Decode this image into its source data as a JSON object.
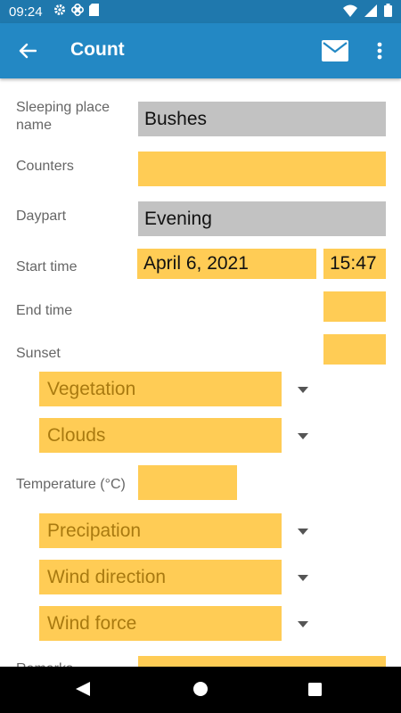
{
  "status_bar": {
    "time": "09:24"
  },
  "app_bar": {
    "title": "Count"
  },
  "form": {
    "sleeping_place_label": "Sleeping place name",
    "sleeping_place_value": "Bushes",
    "counters_label": "Counters",
    "counters_value": "",
    "daypart_label": "Daypart",
    "daypart_value": "Evening",
    "start_time_label": "Start time",
    "start_date_value": "April 6, 2021",
    "start_time_value": "15:47",
    "end_time_label": "End time",
    "end_time_value": "",
    "sunset_label": "Sunset",
    "sunset_value": "",
    "vegetation_value": "Vegetation",
    "clouds_value": "Clouds",
    "temperature_label": "Temperature (°C)",
    "temperature_value": "",
    "precipitation_value": "Precipation",
    "wind_direction_value": "Wind direction",
    "wind_force_value": "Wind force",
    "remarks_label": "Remarks",
    "remarks_value": ""
  },
  "colors": {
    "status_bar": "#1f78ad",
    "app_bar": "#2388c4",
    "field_yellow": "#ffcc55",
    "field_grey": "#c2c2c2"
  }
}
